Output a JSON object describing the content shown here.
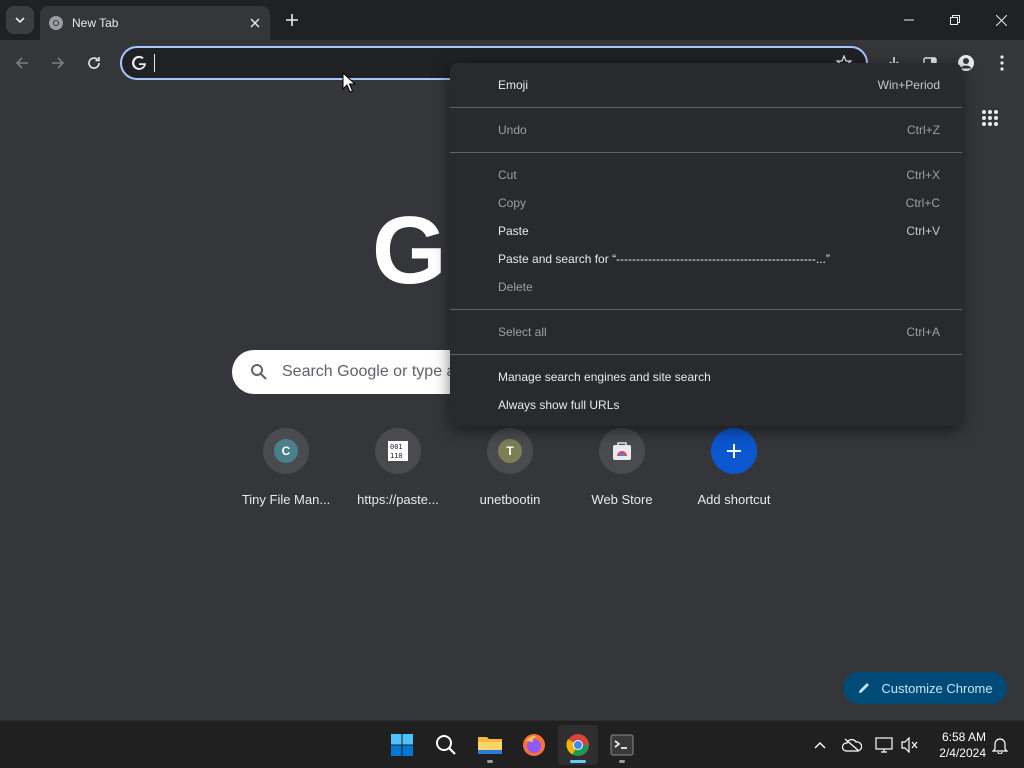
{
  "tab": {
    "title": "New Tab"
  },
  "omnibox": {
    "value": ""
  },
  "ntp": {
    "logo": "G",
    "search_placeholder": "Search Google or type a URL",
    "shortcuts": [
      {
        "label": "Tiny File Man...",
        "letter": "C",
        "color": "#4a7f8c"
      },
      {
        "label": "https://paste...",
        "letter": "",
        "color": ""
      },
      {
        "label": "unetbootin",
        "letter": "T",
        "color": "#7c7f55"
      },
      {
        "label": "Web Store",
        "letter": "",
        "color": ""
      },
      {
        "label": "Add shortcut",
        "letter": "",
        "color": "#0b57d0"
      }
    ],
    "customize_label": "Customize Chrome"
  },
  "context_menu": {
    "items": [
      {
        "label": "Emoji",
        "shortcut": "Win+Period",
        "enabled": true
      },
      {
        "label": "Undo",
        "shortcut": "Ctrl+Z",
        "enabled": false
      },
      {
        "label": "Cut",
        "shortcut": "Ctrl+X",
        "enabled": false
      },
      {
        "label": "Copy",
        "shortcut": "Ctrl+C",
        "enabled": false
      },
      {
        "label": "Paste",
        "shortcut": "Ctrl+V",
        "enabled": true
      },
      {
        "label": "Paste and search for “--------------------------------------------------...”",
        "shortcut": "",
        "enabled": true
      },
      {
        "label": "Delete",
        "shortcut": "",
        "enabled": false
      },
      {
        "label": "Select all",
        "shortcut": "Ctrl+A",
        "enabled": false
      },
      {
        "label": "Manage search engines and site search",
        "shortcut": "",
        "enabled": true
      },
      {
        "label": "Always show full URLs",
        "shortcut": "",
        "enabled": true
      }
    ]
  },
  "taskbar": {
    "time": "6:58 AM",
    "date": "2/4/2024"
  },
  "colors": {
    "accent": "#a8c7fa",
    "customize_bg": "#004a77",
    "taskbar_active": "#60cdff"
  },
  "icons": [
    "tab-search-icon",
    "chrome-favicon",
    "close-icon",
    "plus-icon",
    "minimize-icon",
    "restore-icon",
    "window-close-icon",
    "back-arrow-icon",
    "forward-arrow-icon",
    "reload-icon",
    "google-g-icon",
    "bookmark-star-icon",
    "download-icon",
    "side-panel-icon",
    "profile-icon",
    "more-vert-icon",
    "apps-grid-icon",
    "search-icon",
    "pencil-icon",
    "windows-start-icon",
    "file-explorer-icon",
    "firefox-icon",
    "chrome-icon",
    "terminal-icon",
    "chevron-up-icon",
    "onedrive-icon",
    "network-icon",
    "volume-muted-icon",
    "notification-bell-icon"
  ]
}
